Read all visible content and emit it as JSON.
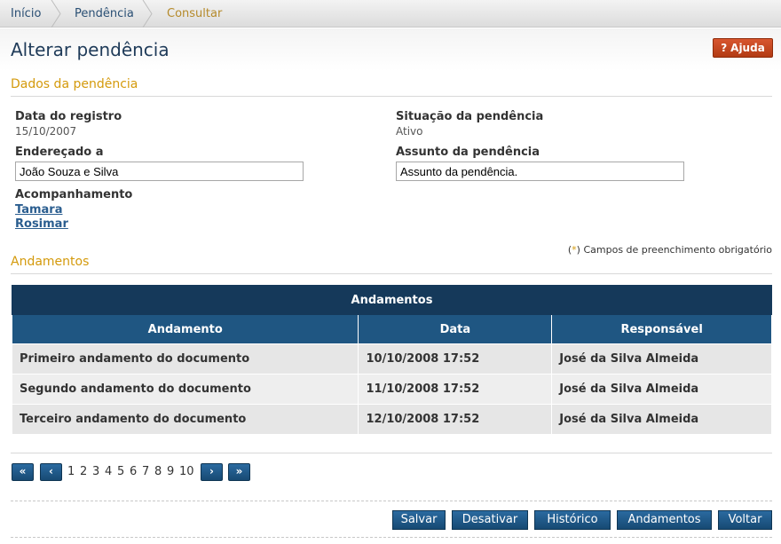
{
  "breadcrumb": [
    "Início",
    "Pendência",
    "Consultar"
  ],
  "page": {
    "title": "Alterar pendência",
    "help_label": "Ajuda"
  },
  "section_details": {
    "title": "Dados da pendência",
    "registration_date_label": "Data do registro",
    "registration_date": "15/10/2007",
    "status_label": "Situação da pendência",
    "status": "Ativo",
    "addressed_to_label": "Endereçado a",
    "addressed_to": "João Souza e Silva",
    "subject_label": "Assunto da pendência",
    "subject": "Assunto da pendência.",
    "follow_up_label": "Acompanhamento",
    "follow_up": [
      "Tamara",
      "Rosimar"
    ],
    "required_note_star": "*",
    "required_note_text": "Campos de preenchimento obrigatório"
  },
  "section_progress": {
    "title": "Andamentos",
    "table_caption": "Andamentos",
    "columns": [
      "Andamento",
      "Data",
      "Responsável"
    ],
    "rows": [
      [
        "Primeiro andamento do documento",
        "10/10/2008 17:52",
        "José da Silva Almeida"
      ],
      [
        "Segundo andamento do documento",
        "11/10/2008 17:52",
        "José da Silva Almeida"
      ],
      [
        "Terceiro andamento do documento",
        "12/10/2008 17:52",
        "José da Silva Almeida"
      ]
    ]
  },
  "pagination": {
    "first": "«",
    "prev": "‹",
    "pages": [
      "1",
      "2",
      "3",
      "4",
      "5",
      "6",
      "7",
      "8",
      "9",
      "10"
    ],
    "next": "›",
    "last": "»"
  },
  "actions": [
    "Salvar",
    "Desativar",
    "Histórico",
    "Andamentos",
    "Voltar"
  ],
  "colors": {
    "title": "#1f3b59",
    "section": "#d49a0c",
    "table_header": "#15395a",
    "button": "#1f5682",
    "help": "#c44a21"
  }
}
